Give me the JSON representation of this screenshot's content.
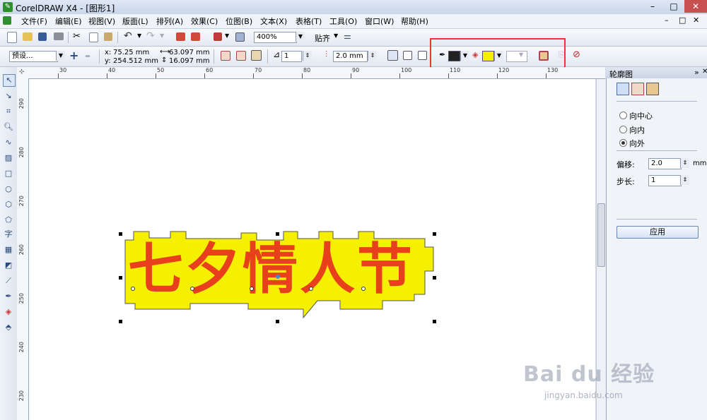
{
  "window": {
    "title": "CorelDRAW X4 - [图形1]"
  },
  "menu": [
    "文件(F)",
    "编辑(E)",
    "视图(V)",
    "版面(L)",
    "排列(A)",
    "效果(C)",
    "位图(B)",
    "文本(X)",
    "表格(T)",
    "工具(O)",
    "窗口(W)",
    "帮助(H)"
  ],
  "toolbar": {
    "zoom": "400%",
    "snap_label": "贴齐"
  },
  "propbar": {
    "preset": "预设...",
    "x": "75.25 mm",
    "y": "254.512 mm",
    "width": "63.097 mm",
    "height": "16.097 mm",
    "steps": "1",
    "offset": "2.0 mm",
    "outline_color": "#222222",
    "fill_color": "#f5ef00"
  },
  "ruler": {
    "h_ticks": [
      "30",
      "40",
      "50",
      "60",
      "70",
      "80",
      "90",
      "100",
      "110",
      "120",
      "130"
    ],
    "v_ticks": [
      "290",
      "280",
      "270",
      "260",
      "250",
      "240",
      "230"
    ]
  },
  "canvas": {
    "artwork_text": "七夕情人节",
    "text_color": "#e8401c",
    "contour_color": "#f5ef00"
  },
  "docker": {
    "title": "轮廓图",
    "options": [
      "向中心",
      "向内",
      "向外"
    ],
    "selected_option": "向外",
    "offset_label": "偏移:",
    "offset_value": "2.0",
    "offset_unit": "mm",
    "steps_label": "步长:",
    "steps_value": "1",
    "apply_label": "应用"
  },
  "watermark": {
    "logo": "Bai du 经验",
    "url": "jingyan.baidu.com"
  }
}
